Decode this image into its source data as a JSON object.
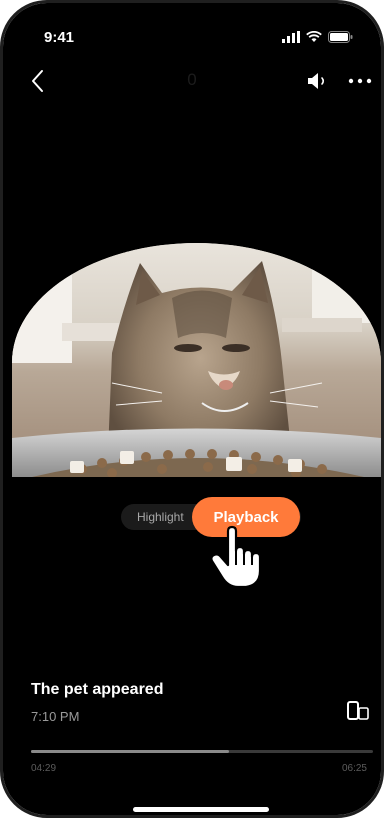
{
  "status_bar": {
    "time": "9:41"
  },
  "nav": {
    "title": "0"
  },
  "toggle": {
    "highlight_label": "Highlight",
    "playback_label": "Playback",
    "active_color": "#ff7a3a"
  },
  "event": {
    "title": "The pet appeared",
    "time": "7:10 PM"
  },
  "progress": {
    "start": "04:29",
    "end": "06:25",
    "fraction": 0.58
  },
  "icons": [
    "back-arrow-icon",
    "speaker-icon",
    "more-icon",
    "rotate-screen-icon",
    "hand-cursor-icon",
    "signal-icon",
    "wifi-icon",
    "battery-icon"
  ]
}
